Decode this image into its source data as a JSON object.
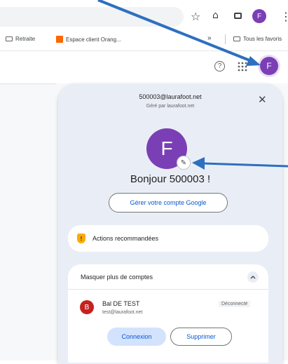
{
  "bookmarks": {
    "items": [
      {
        "label": "Retraite"
      },
      {
        "label": "Espace client Orang..."
      },
      {
        "label": "Tous les favoris"
      }
    ],
    "more": "»"
  },
  "toolbar": {
    "profile_initial": "F"
  },
  "header": {
    "profile_initial": "F"
  },
  "account_panel": {
    "email": "500003@laurafoot.net",
    "managed_by": "Géré par laurafoot.net",
    "avatar_initial": "F",
    "greeting": "Bonjour 500003 !",
    "manage_button": "Gérer votre compte Google",
    "recommended_actions": "Actions recommandées",
    "hide_accounts": "Masquer plus de comptes",
    "other_account": {
      "initial": "B",
      "name": "Bal DE TEST",
      "email": "test@laurafoot.net",
      "status": "Déconnecté",
      "connect_button": "Connexion",
      "delete_button": "Supprimer"
    }
  },
  "colors": {
    "accent_blue": "#0b57d0",
    "avatar_purple": "#7b3fb5",
    "account_red": "#c5221f",
    "warning_yellow": "#f9ab00",
    "arrow_blue": "#2e6fc0",
    "panel_bg": "#e9eef6"
  }
}
